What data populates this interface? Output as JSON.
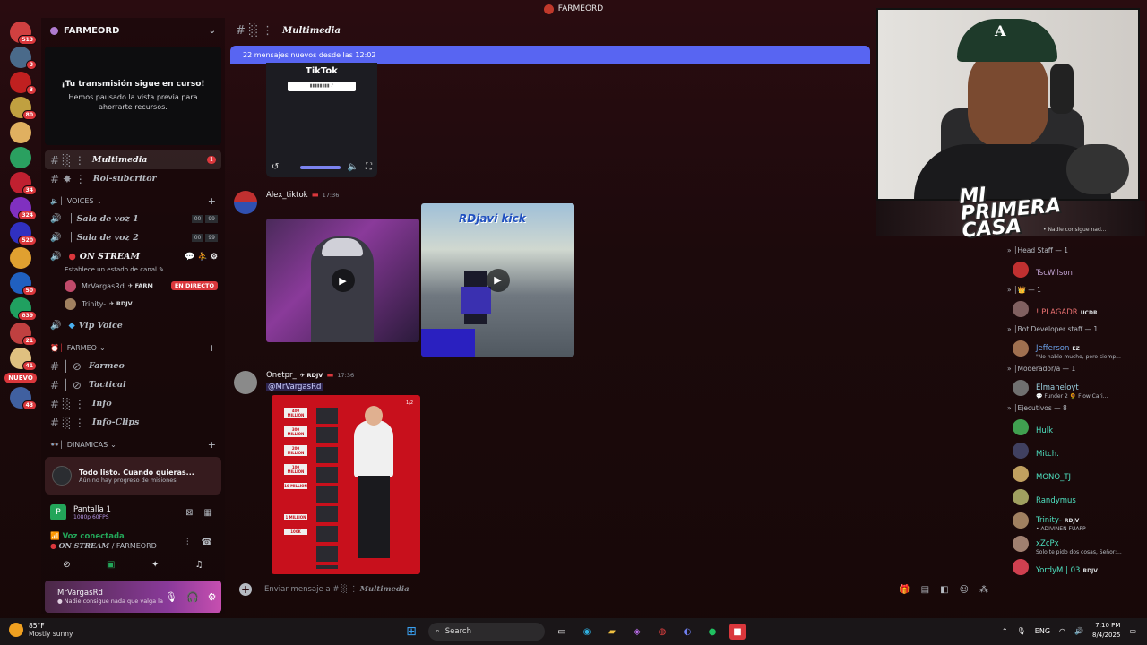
{
  "window": {
    "title": "FARMEORD"
  },
  "rail": {
    "servers": [
      {
        "color": "#d04040",
        "badge": "513"
      },
      {
        "color": "#4a6a8a",
        "badge": "3"
      },
      {
        "color": "#c02020",
        "badge": "3"
      },
      {
        "color": "#c0a040",
        "badge": "80"
      },
      {
        "color": "#e0b060",
        "badge": ""
      },
      {
        "color": "#2aa060",
        "badge": ""
      },
      {
        "color": "#c02030",
        "badge": "34"
      },
      {
        "color": "#8030c0",
        "badge": "324"
      },
      {
        "color": "#3030c0",
        "badge": "520"
      },
      {
        "color": "#e0a030",
        "badge": ""
      },
      {
        "color": "#2060c0",
        "badge": "50"
      },
      {
        "color": "#20a060",
        "badge": "839"
      },
      {
        "color": "#c04040",
        "badge": "21"
      },
      {
        "color": "#e0c080",
        "badge": "41"
      },
      {
        "color": "#4060a0",
        "badge": "43"
      }
    ],
    "new_label": "NUEVO"
  },
  "sidebar": {
    "server_name": "FARMEORD",
    "preview": {
      "title": "¡Tu transmisión sigue en curso!",
      "text": "Hemos pausado la vista previa para ahorrarte recursos."
    },
    "channels_top": [
      {
        "prefix": "░ ⋮",
        "name": "Multimedia",
        "unread": "1",
        "active": true
      },
      {
        "prefix": "✸ ⋮",
        "name": "Rol-subcritor",
        "unread": "",
        "active": false
      }
    ],
    "cat_voices": "VOICES",
    "voice_channels": [
      {
        "prefix": "│",
        "name": "Sala de voz 1",
        "c1": "00",
        "c2": "99"
      },
      {
        "prefix": "│",
        "name": "Sala de voz 2",
        "c1": "00",
        "c2": "99"
      }
    ],
    "on_stream": {
      "name": "ON STREAM",
      "status": "Establece un estado de canal ✎"
    },
    "voice_users": [
      {
        "name": "MrVargasRd",
        "tag": "✈ FARM",
        "live": "EN DIRECTO",
        "color": "#c04a6a"
      },
      {
        "name": "Trinity-",
        "tag": "✈ RDJV",
        "live": "",
        "color": "#a08060"
      }
    ],
    "vip": "Vip Voice",
    "cat_farmeo": "FARMEO",
    "farmeo_channels": [
      {
        "prefix": "│ ⊘",
        "name": "Farmeo"
      },
      {
        "prefix": "│ ⊘",
        "name": "Tactical"
      },
      {
        "prefix": "░ ⋮",
        "name": "Info"
      },
      {
        "prefix": "░ ⋮",
        "name": "Info-Clips"
      }
    ],
    "cat_dinamicas": "DINAMICAS",
    "quest": {
      "title": "Todo listo. Cuando quieras...",
      "sub": "Aún no hay progreso de misiones"
    },
    "screen": {
      "title": "Pantalla 1",
      "sub": "1080p 60FPS"
    },
    "voice": {
      "status": "Voz conectada",
      "channel": "ON STREAM",
      "server": "/ FARMEORD"
    },
    "user": {
      "name": "MrVargasRd",
      "status": "● Nadie consigue nada que valga la p..."
    }
  },
  "main": {
    "channel_title": "Multimedia",
    "new_messages": "22 mensajes nuevos desde las 12:02",
    "tiktok_label": "TikTok",
    "messages": [
      {
        "author": "Alex_tiktok",
        "time": "17:36",
        "color": "#f2f3f5",
        "badge": "",
        "video_title": "RDjavi kick"
      },
      {
        "author": "Onetpr_",
        "badge": "✈ RDJV",
        "time": "17:36",
        "mention": "@MrVargasRd",
        "img_counter": "1/2"
      }
    ],
    "milestones": [
      "400 MILLION",
      "300 MILLION",
      "200 MILLION",
      "100 MILLION",
      "10 MILLION",
      "1 MILLION",
      "100K"
    ],
    "composer_prefix": "Enviar mensaje a #",
    "composer_channel": "Multimedia"
  },
  "cam": {
    "overlay": "MI PRIMERA CASA",
    "ticker": "• Nadie consigue nad..."
  },
  "members": [
    {
      "group": "Head Staff — 1",
      "items": [
        {
          "name": "TscWilson",
          "color": "#c0a0d0",
          "status": "",
          "tag": "",
          "avatar": "#c03030"
        }
      ]
    },
    {
      "group": "👑 — 1",
      "items": [
        {
          "name": "! PLAGADR",
          "color": "#e87070",
          "status": "",
          "tag": "UCDR",
          "avatar": "#806060"
        }
      ]
    },
    {
      "group": "Bot Developer staff — 1",
      "items": [
        {
          "name": "Jefferson",
          "color": "#6aa0e8",
          "status": "\"No hablo mucho, pero siemp...",
          "tag": "EZ",
          "avatar": "#a07050"
        }
      ]
    },
    {
      "group": "Moderador/a — 1",
      "items": [
        {
          "name": "Elmaneloyt",
          "color": "#9ad0e0",
          "status": "💬 Funder 2 🌻 Flow Cari...",
          "tag": "",
          "avatar": "#707070"
        }
      ]
    },
    {
      "group": "Ejecutivos — 8",
      "items": [
        {
          "name": "Hulk",
          "color": "#4ee0c0",
          "status": "",
          "tag": "",
          "avatar": "#40a050"
        },
        {
          "name": "Mitch.",
          "color": "#4ee0c0",
          "status": "",
          "tag": "",
          "avatar": "#404060"
        },
        {
          "name": "MONO_TJ",
          "color": "#4ee0c0",
          "status": "",
          "tag": "",
          "avatar": "#c0a060"
        },
        {
          "name": "Randymus",
          "color": "#4ee0c0",
          "status": "",
          "tag": "",
          "avatar": "#a0a060"
        },
        {
          "name": "Trinity-",
          "color": "#4ee0c0",
          "status": "• ADIVINEN FUAPP",
          "tag": "RDJV",
          "avatar": "#a08060"
        },
        {
          "name": "xZcPx",
          "color": "#4ee0c0",
          "status": "Solo te pido dos cosas, Señor:...",
          "tag": "",
          "avatar": "#a08070"
        },
        {
          "name": "YordyM | 03",
          "color": "#4ee0c0",
          "status": "",
          "tag": "RDJV",
          "avatar": "#d04050"
        }
      ]
    }
  ],
  "taskbar": {
    "temp": "85°F",
    "weather": "Mostly sunny",
    "search": "Search",
    "lang": "ENG",
    "time": "7:10 PM",
    "date": "8/4/2025"
  }
}
